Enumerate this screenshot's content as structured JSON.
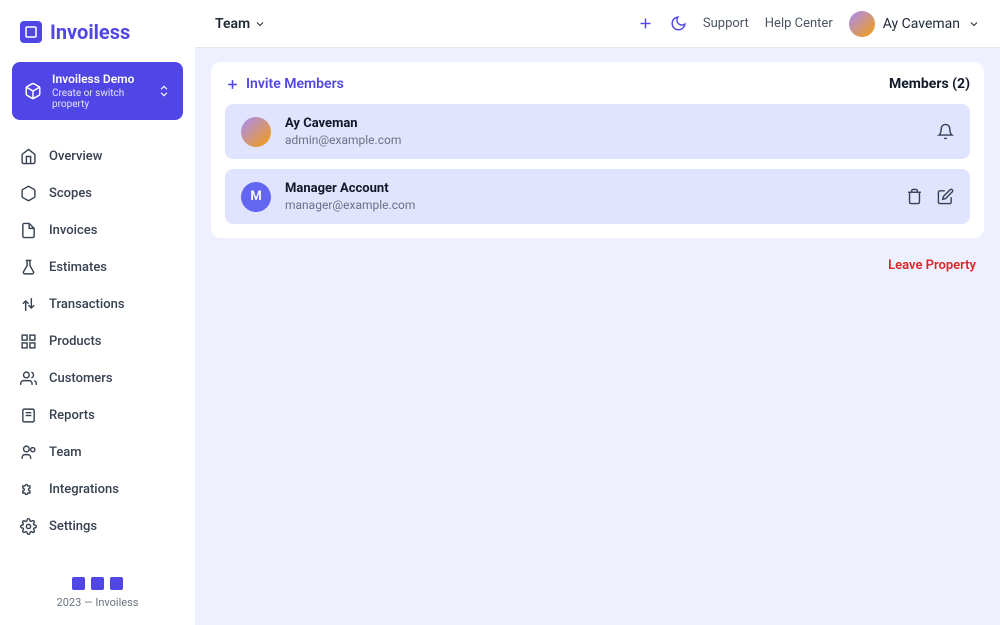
{
  "brand": "Invoiless",
  "property": {
    "name": "Invoiless Demo",
    "subtitle": "Create or switch property"
  },
  "nav": [
    {
      "key": "overview",
      "label": "Overview"
    },
    {
      "key": "scopes",
      "label": "Scopes"
    },
    {
      "key": "invoices",
      "label": "Invoices"
    },
    {
      "key": "estimates",
      "label": "Estimates"
    },
    {
      "key": "transactions",
      "label": "Transactions"
    },
    {
      "key": "products",
      "label": "Products"
    },
    {
      "key": "customers",
      "label": "Customers"
    },
    {
      "key": "reports",
      "label": "Reports"
    },
    {
      "key": "team",
      "label": "Team"
    },
    {
      "key": "integrations",
      "label": "Integrations"
    },
    {
      "key": "settings",
      "label": "Settings"
    }
  ],
  "footer": {
    "copyright": "2023 — Invoiless"
  },
  "topbar": {
    "title": "Team",
    "support": "Support",
    "help_center": "Help Center",
    "user_name": "Ay Caveman"
  },
  "team": {
    "invite_label": "Invite Members",
    "count_label": "Members (2)",
    "members": [
      {
        "name": "Ay Caveman",
        "email": "admin@example.com",
        "initial": "",
        "has_bell": true,
        "has_actions": false
      },
      {
        "name": "Manager Account",
        "email": "manager@example.com",
        "initial": "M",
        "has_bell": false,
        "has_actions": true
      }
    ],
    "leave_label": "Leave Property"
  }
}
